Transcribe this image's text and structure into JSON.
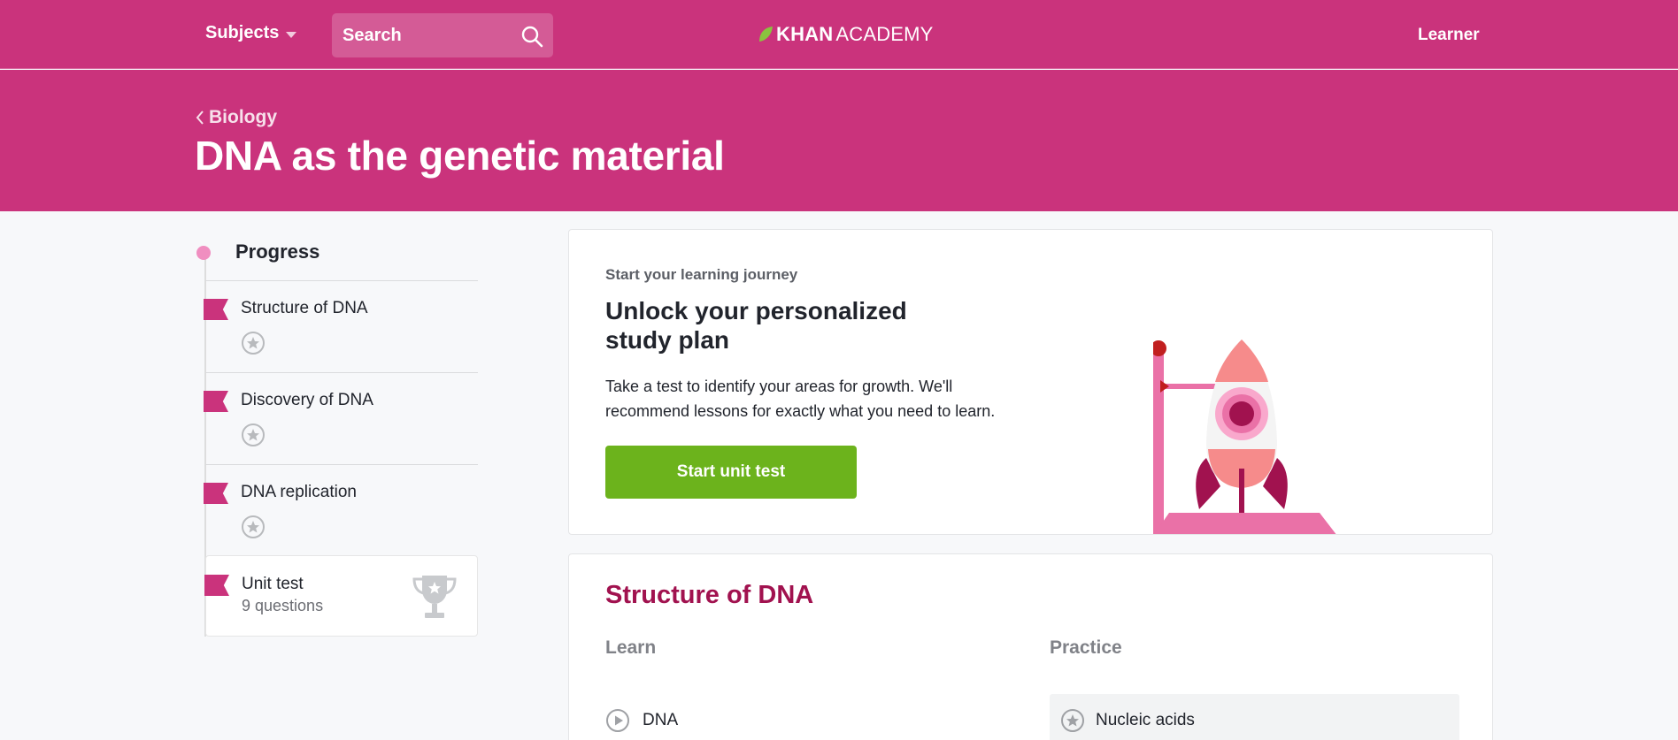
{
  "header": {
    "subjects_label": "Subjects",
    "search_placeholder": "Search",
    "logo_bold": "KHAN",
    "logo_light": "ACADEMY",
    "learner_label": "Learner"
  },
  "hero": {
    "breadcrumb": "Biology",
    "title": "DNA as the genetic material"
  },
  "sidebar": {
    "progress_label": "Progress",
    "items": [
      {
        "label": "Structure of DNA"
      },
      {
        "label": "Discovery of DNA"
      },
      {
        "label": "DNA replication"
      }
    ],
    "unit_test": {
      "label": "Unit test",
      "sub": "9 questions"
    }
  },
  "journey": {
    "kicker": "Start your learning journey",
    "heading": "Unlock your personalized study plan",
    "description": "Take a test to identify your areas for growth. We'll recommend lessons for exactly what you need to learn.",
    "button_label": "Start unit test"
  },
  "structure": {
    "title": "Structure of DNA",
    "learn_header": "Learn",
    "practice_header": "Practice",
    "learn_item": "DNA",
    "practice_item": "Nucleic acids"
  },
  "colors": {
    "brand": "#ca337c",
    "accent_dark": "#a1124f",
    "button_green": "#6cb31c"
  }
}
